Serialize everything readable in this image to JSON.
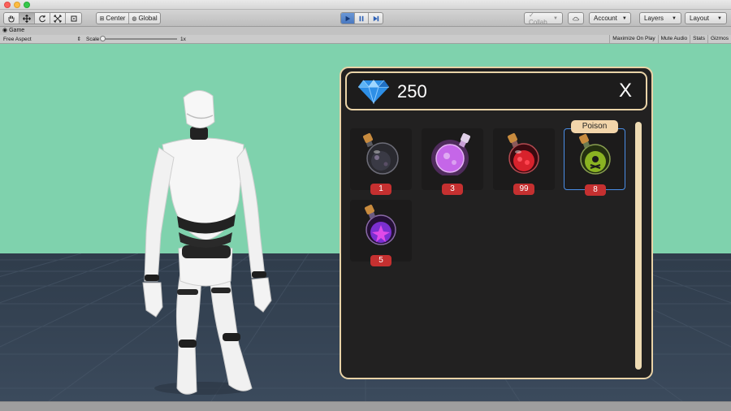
{
  "toolbar": {
    "tools": [
      "hand-tool",
      "move-tool",
      "rotate-tool",
      "scale-tool",
      "rect-tool"
    ],
    "pivot_label": "Center",
    "space_label": "Global",
    "collab_label": "Collab",
    "account_label": "Account",
    "layers_label": "Layers",
    "layout_label": "Layout"
  },
  "game_view": {
    "tab_label": "Game",
    "aspect_label": "Free Aspect",
    "scale_label": "Scale",
    "scale_value": "1x",
    "scale_level": 0,
    "buttons": [
      "Maximize On Play",
      "Mute Audio",
      "Stats",
      "Gizmos"
    ]
  },
  "inventory": {
    "currency_icon": "diamond-icon",
    "currency_amount": "250",
    "close_label": "X",
    "items": [
      {
        "count": "1",
        "color": "#3a3a45",
        "icon": "dark-potion-icon"
      },
      {
        "count": "3",
        "color": "#b04ad8",
        "icon": "purple-glow-potion-icon"
      },
      {
        "count": "99",
        "color": "#d8222c",
        "icon": "red-potion-icon"
      },
      {
        "count": "8",
        "color": "#8ab322",
        "icon": "poison-potion-icon",
        "tooltip": "Poison",
        "selected": true
      },
      {
        "count": "5",
        "color": "#7b2fd0",
        "icon": "violet-flower-potion-icon"
      }
    ]
  },
  "colors": {
    "sky": "#7fd2ad",
    "panel_border": "#e9d3a7",
    "badge": "#c53030",
    "selection": "#4a8ee6"
  }
}
